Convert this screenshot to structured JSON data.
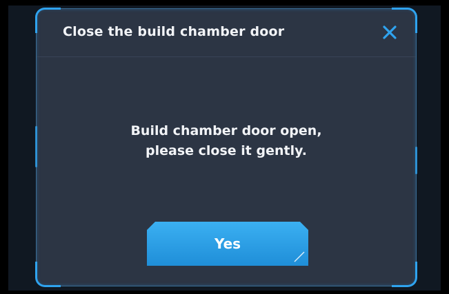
{
  "dialog": {
    "title": "Close the build chamber door",
    "close_icon": "close-icon",
    "message_lines": [
      "Build chamber door open,",
      "please close it gently."
    ],
    "confirm_label": "Yes"
  },
  "colors": {
    "background": "#000000",
    "dialog_fill": "#2c3544",
    "accent": "#2fa3ef",
    "button_fill": "#2d9fe6",
    "text": "#f2f4f7"
  }
}
